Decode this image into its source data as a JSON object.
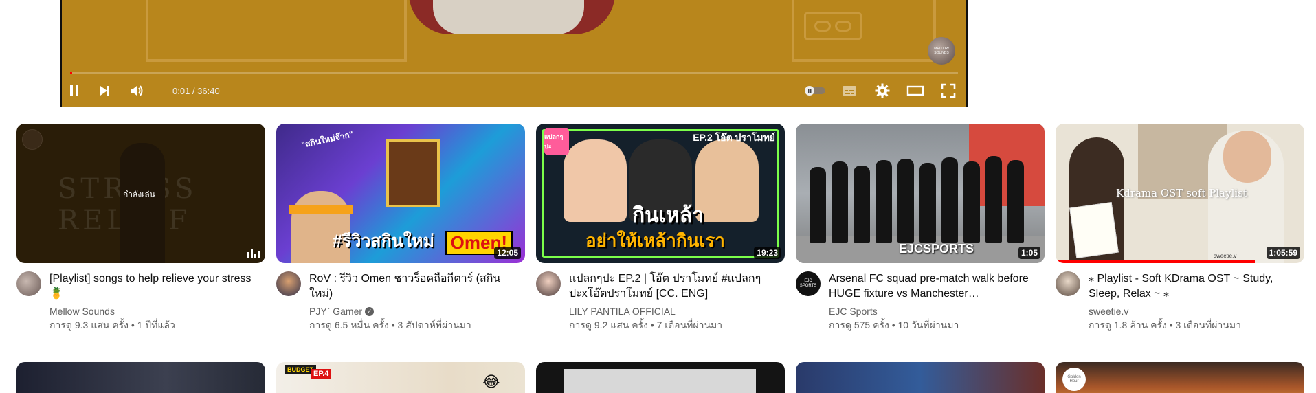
{
  "player": {
    "current_time": "0:01",
    "duration": "36:40",
    "time_text": "0:01 / 36:40",
    "progress": 0.0005,
    "watermark": "MELLOW SOUNDS",
    "controls": {
      "pause": "pause-icon",
      "next": "next-icon",
      "volume": "volume-icon",
      "autoplay": "autoplay-toggle",
      "subtitles": "subtitles-icon",
      "settings": "gear-icon",
      "theater": "theater-mode-icon",
      "fullscreen": "fullscreen-icon"
    }
  },
  "videos": [
    {
      "title": "[Playlist] songs to help relieve your stress 🍍",
      "channel": "Mellow Sounds",
      "stats": "การดู 9.3 แสน ครั้ง • 1 ปีที่แล้ว",
      "overlay": "กำลังเล่น",
      "thumb_text": "STRESS RELIEF",
      "verified": false
    },
    {
      "title": "RoV : รีวิว Omen ชาวร็อคถือกีตาร์ (สกินใหม่)",
      "channel": "PJY` Gamer",
      "stats": "การดู 6.5 หมื่น ครั้ง • 3 สัปดาห์ที่ผ่านมา",
      "duration": "12:05",
      "thumb_text": "#รีวิวสกินใหม่",
      "thumb_badge": "Omen!",
      "thumb_tag": "\"สกินใหม่จ๊าก\"",
      "verified": true
    },
    {
      "title": "แปลกๆปะ EP.2 | โอ๊ต ปราโมทย์ #แปลกๆปะxโอ๊ตปราโมทย์ [CC. ENG]",
      "channel": "LILY PANTILA OFFICIAL",
      "stats": "การดู 9.2 แสน ครั้ง • 7 เดือนที่ผ่านมา",
      "duration": "19:23",
      "thumb_text": "กินเหล้า",
      "thumb_text2": "อย่าให้เหล้ากินเรา",
      "thumb_ep": "EP.2 โอ๊ต ปราโมทย์",
      "thumb_logo": "แปลกๆปะ",
      "verified": false
    },
    {
      "title": "Arsenal FC squad pre-match walk before HUGE fixture vs Manchester…",
      "channel": "EJC Sports",
      "stats": "การดู 575 ครั้ง • 10 วันที่ผ่านมา",
      "duration": "1:05",
      "thumb_text": "EJCSPORTS",
      "avatar_text": "EJC SPORTS",
      "verified": false
    },
    {
      "title": "⁎ Playlist - Soft KDrama OST ~ Study, Sleep, Relax ~ ⁎",
      "channel": "sweetie.v",
      "stats": "การดู 1.8 ล้าน ครั้ง • 3 เดือนที่ผ่านมา",
      "duration": "1:05:59",
      "thumb_text": "Kdrama OST soft Playlist",
      "thumb_small": "sweetie.v",
      "watch_progress": 0.8,
      "verified": false
    }
  ],
  "row2": {
    "b_badge": "BUDGET",
    "b_ep": "EP.4",
    "e_mini": "Golden Hour"
  }
}
